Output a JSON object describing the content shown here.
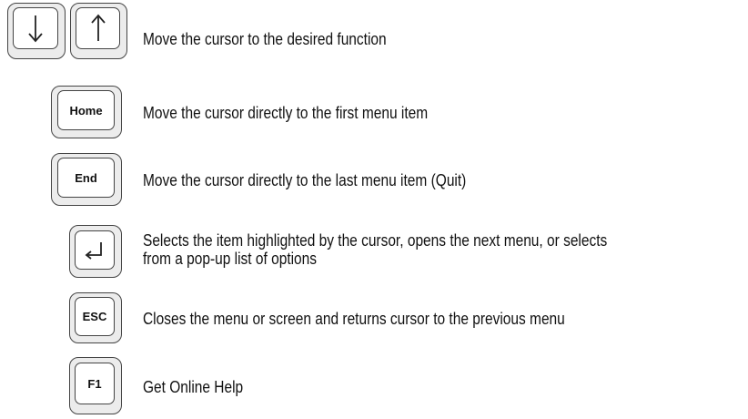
{
  "rows": [
    {
      "keys": [
        {
          "name": "down-arrow-key",
          "icon": "down-arrow-icon"
        },
        {
          "name": "up-arrow-key",
          "icon": "up-arrow-icon"
        }
      ],
      "description": "Move the cursor to the desired function"
    },
    {
      "keys": [
        {
          "name": "home-key",
          "label": "Home"
        }
      ],
      "description": "Move the cursor directly to the first menu item"
    },
    {
      "keys": [
        {
          "name": "end-key",
          "label": "End"
        }
      ],
      "description_pre": "Move the cursor directly to the last menu item (",
      "description_keyword": "Quit",
      "description_post": ")"
    },
    {
      "keys": [
        {
          "name": "enter-key",
          "icon": "enter-return-icon"
        }
      ],
      "description_lines": [
        "Selects the item highlighted by the cursor, opens the next menu, or selects",
        "from a pop-up list of options"
      ]
    },
    {
      "keys": [
        {
          "name": "esc-key",
          "label": "ESC"
        }
      ],
      "description": "Closes the menu or screen and returns cursor to the previous menu"
    },
    {
      "keys": [
        {
          "name": "f1-key",
          "label": "F1"
        }
      ],
      "description": "Get Online Help"
    }
  ]
}
